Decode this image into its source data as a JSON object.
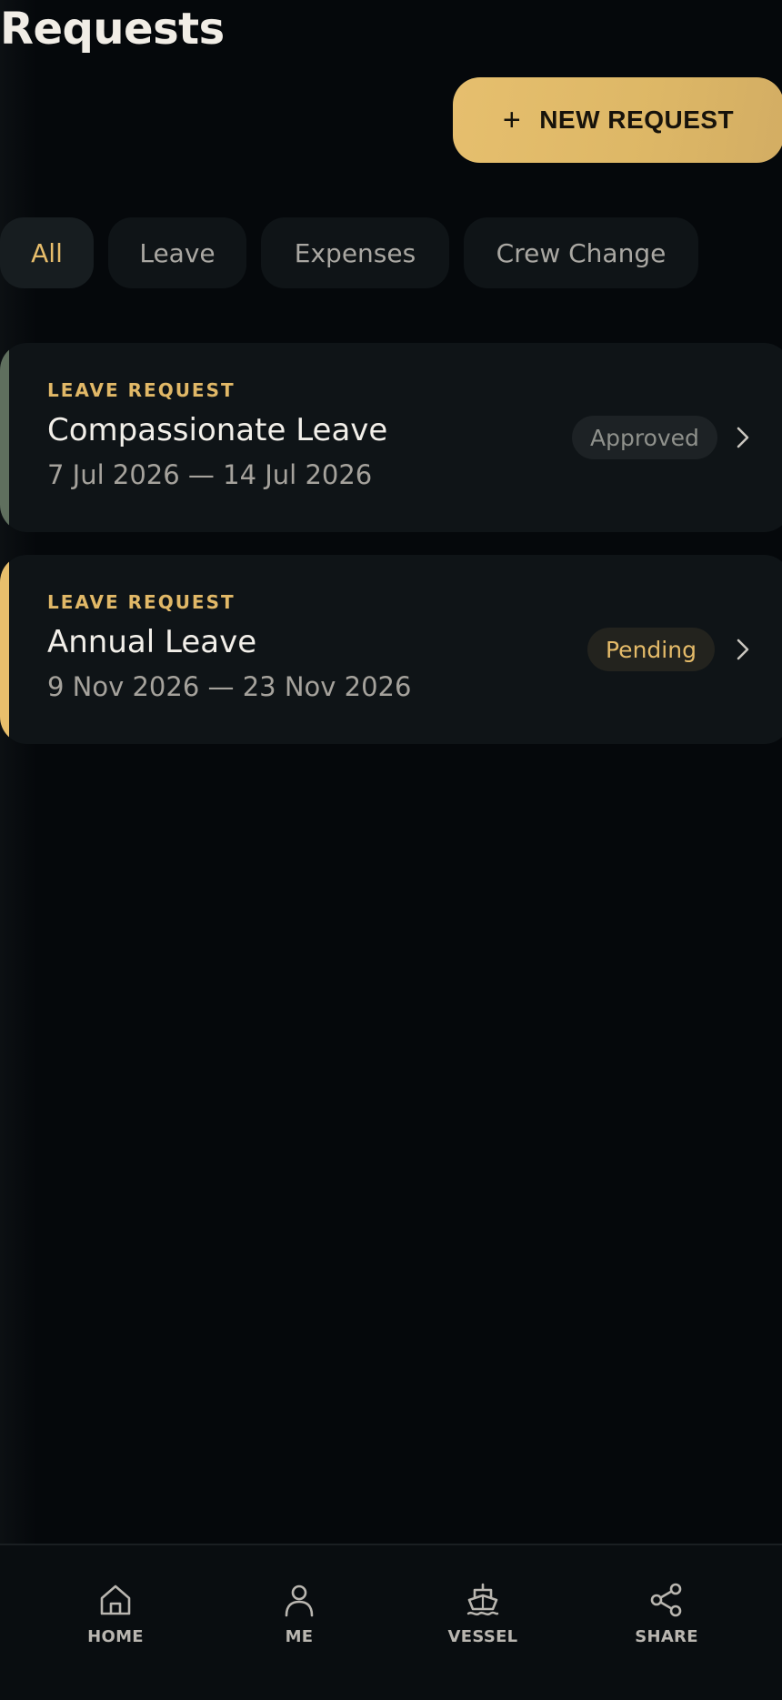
{
  "header": {
    "title": "Requests"
  },
  "actions": {
    "new_request_label": "NEW REQUEST"
  },
  "filters": [
    {
      "label": "All",
      "active": true
    },
    {
      "label": "Leave",
      "active": false
    },
    {
      "label": "Expenses",
      "active": false
    },
    {
      "label": "Crew Change",
      "active": false
    }
  ],
  "requests": [
    {
      "kicker": "LEAVE REQUEST",
      "name": "Compassionate Leave",
      "dates": "7 Jul 2026 — 14 Jul 2026",
      "status": "Approved",
      "accent_color": "#5f6f5e",
      "status_color": "#8f918c"
    },
    {
      "kicker": "LEAVE REQUEST",
      "name": "Annual Leave",
      "dates": "9 Nov 2026 — 23 Nov 2026",
      "status": "Pending",
      "accent_color": "#e8bf6c",
      "status_color": "#e5bb69"
    }
  ],
  "bottom_nav": [
    {
      "label": "HOME",
      "icon": "home-icon"
    },
    {
      "label": "ME",
      "icon": "person-icon"
    },
    {
      "label": "VESSEL",
      "icon": "ship-icon"
    },
    {
      "label": "SHARE",
      "icon": "share-icon"
    }
  ],
  "colors": {
    "accent": "#e1b867",
    "background": "#05080b",
    "surface": "#0f1417"
  }
}
